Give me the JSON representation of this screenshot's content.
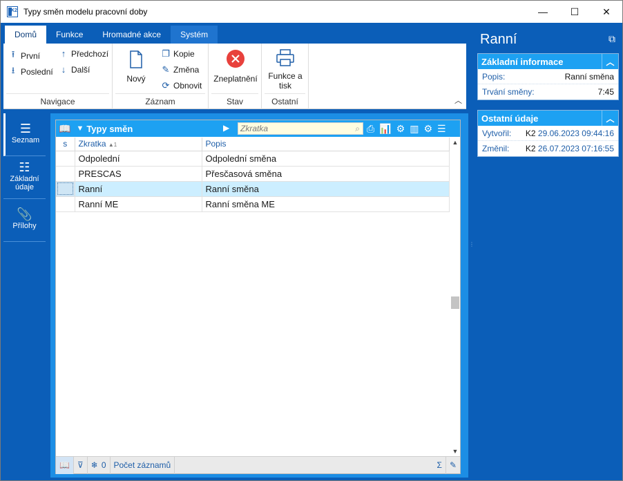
{
  "window": {
    "title": "Typy směn modelu pracovní doby",
    "app_icon_text": "K2",
    "minimize": "—",
    "maximize": "☐",
    "close": "✕"
  },
  "ribbon": {
    "tabs": [
      {
        "label": "Domů",
        "active": true
      },
      {
        "label": "Funkce"
      },
      {
        "label": "Hromadné akce"
      },
      {
        "label": "Systém"
      }
    ],
    "groups": {
      "navigace": {
        "label": "Navigace",
        "first": "První",
        "last": "Poslední",
        "prev": "Předchozí",
        "next": "Další"
      },
      "zaznam": {
        "label": "Záznam",
        "new": "Nový",
        "copy": "Kopie",
        "change": "Změna",
        "refresh": "Obnovit"
      },
      "stav": {
        "label": "Stav",
        "invalidate": "Zneplatnění"
      },
      "ostatni": {
        "label": "Ostatní",
        "print_line1": "Funkce a",
        "print_line2": "tisk"
      }
    }
  },
  "leftnav": {
    "items": [
      {
        "label": "Seznam",
        "icon": "hamburger-icon"
      },
      {
        "label_line1": "Základní",
        "label_line2": "údaje",
        "icon": "list-icon"
      },
      {
        "label": "Přílohy",
        "icon": "paperclip-icon"
      }
    ]
  },
  "list": {
    "title": "Typy směn",
    "search_placeholder": "Zkratka",
    "columns": {
      "s": "s",
      "code": "Zkratka",
      "sort_indicator": "▲1",
      "desc": "Popis"
    },
    "rows": [
      {
        "code": "Odpolední",
        "desc": "Odpolední směna"
      },
      {
        "code": "PRESCAS",
        "desc": "Přesčasová směna"
      },
      {
        "code": "Ranní",
        "desc": "Ranní směna"
      },
      {
        "code": "Ranní ME",
        "desc": "Ranní směna ME"
      }
    ],
    "selected_row_index": 2,
    "status": {
      "filter_count": "0",
      "record_count_label": "Počet záznamů"
    }
  },
  "detail": {
    "title": "Ranní",
    "basic": {
      "header": "Základní informace",
      "desc_label": "Popis:",
      "desc_value": "Ranní směna",
      "duration_label": "Trvání směny:",
      "duration_value": "7:45"
    },
    "other": {
      "header": "Ostatní údaje",
      "created_label": "Vytvořil:",
      "created_user": "K2",
      "created_date": "29.06.2023 09:44:16",
      "changed_label": "Změnil:",
      "changed_user": "K2",
      "changed_date": "26.07.2023 07:16:55"
    }
  }
}
